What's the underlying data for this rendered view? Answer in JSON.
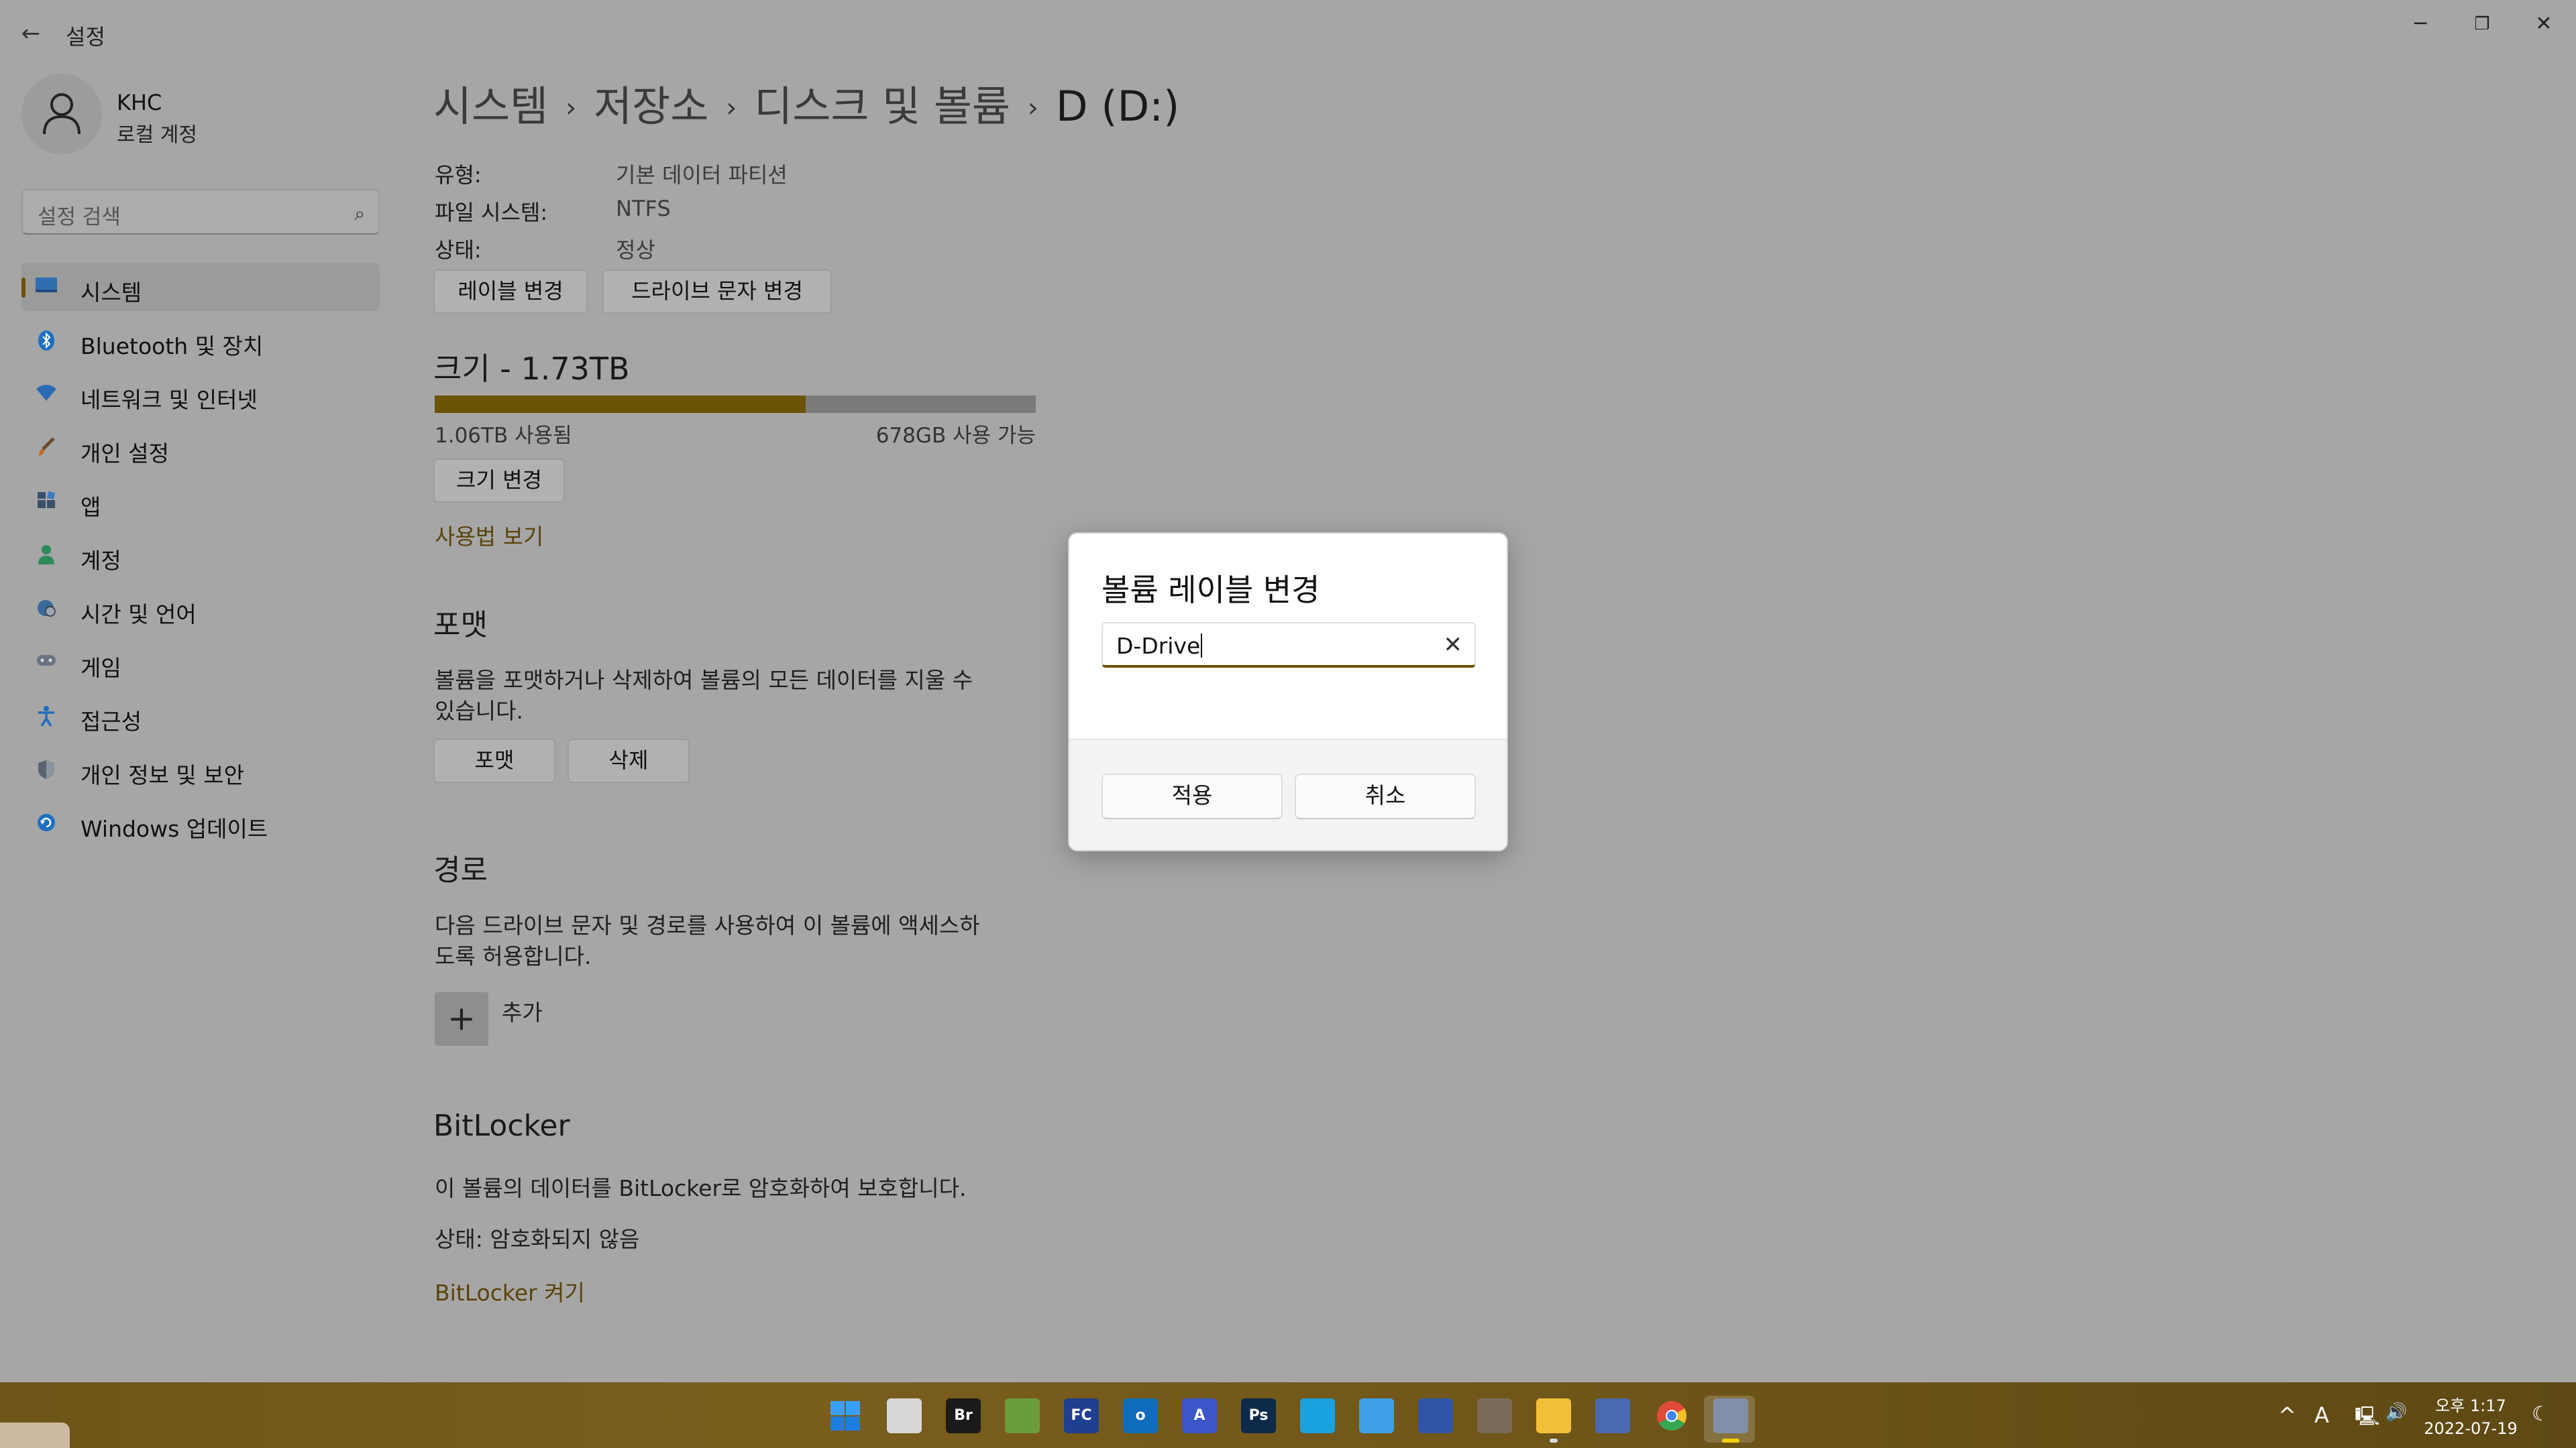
{
  "window": {
    "title": "설정",
    "back": "←",
    "controls": {
      "minimize": "─",
      "restore": "❐",
      "close": "✕"
    }
  },
  "profile": {
    "name": "KHC",
    "account": "로컬 계정"
  },
  "search": {
    "placeholder": "설정 검색"
  },
  "sidebar": {
    "items": [
      {
        "label": "시스템",
        "icon": "system-icon",
        "active": true
      },
      {
        "label": "Bluetooth 및 장치",
        "icon": "bluetooth-icon"
      },
      {
        "label": "네트워크 및 인터넷",
        "icon": "network-icon"
      },
      {
        "label": "개인 설정",
        "icon": "brush-icon"
      },
      {
        "label": "앱",
        "icon": "apps-icon"
      },
      {
        "label": "계정",
        "icon": "account-icon"
      },
      {
        "label": "시간 및 언어",
        "icon": "globe-clock-icon"
      },
      {
        "label": "게임",
        "icon": "gamepad-icon"
      },
      {
        "label": "접근성",
        "icon": "accessibility-icon"
      },
      {
        "label": "개인 정보 및 보안",
        "icon": "shield-icon"
      },
      {
        "label": "Windows 업데이트",
        "icon": "update-icon"
      }
    ]
  },
  "breadcrumb": {
    "items": [
      "시스템",
      "저장소",
      "디스크 및 볼륨",
      "D (D:)"
    ],
    "separator": "›"
  },
  "properties": [
    {
      "key": "유형:",
      "value": "기본 데이터 파티션"
    },
    {
      "key": "파일 시스템:",
      "value": "NTFS"
    },
    {
      "key": "상태:",
      "value": "정상"
    }
  ],
  "actions": {
    "change_label": "레이블 변경",
    "change_letter": "드라이브 문자 변경"
  },
  "size": {
    "title": "크기 - 1.73TB",
    "used": "1.06TB 사용됨",
    "free": "678GB 사용 가능",
    "used_fraction": 0.617,
    "resize": "크기 변경",
    "usage_link": "사용법 보기"
  },
  "format": {
    "title": "포맷",
    "desc_line1": "볼륨을 포맷하거나 삭제하여 볼륨의 모든 데이터를 지울 수",
    "desc_line2": "있습니다.",
    "format_btn": "포맷",
    "delete_btn": "삭제"
  },
  "paths": {
    "title": "경로",
    "desc_line1": "다음 드라이브 문자 및 경로를 사용하여 이 볼륨에 액세스하",
    "desc_line2": "도록 허용합니다.",
    "add_icon": "+",
    "add": "추가"
  },
  "bitlocker": {
    "title": "BitLocker",
    "desc": "이 볼륨의 데이터를 BitLocker로 암호화하여 보호합니다.",
    "status": "상태: 암호화되지 않음",
    "link": "BitLocker 켜기"
  },
  "dialog": {
    "title": "볼륨 레이블 변경",
    "input_value": "D-Drive",
    "clear": "✕",
    "apply": "적용",
    "cancel": "취소"
  },
  "taskbar": {
    "icons": [
      {
        "name": "start-icon",
        "text": "",
        "color": "#2a8cff"
      },
      {
        "name": "task-view-icon",
        "text": "",
        "color": "#d8d8d8"
      },
      {
        "name": "adobe-bridge-icon",
        "text": "Br",
        "color": "#1a1a1a"
      },
      {
        "name": "green-app-icon",
        "text": "",
        "color": "#6b9e3a"
      },
      {
        "name": "fc-app-icon",
        "text": "FC",
        "color": "#1f3f8f"
      },
      {
        "name": "outlook-icon",
        "text": "o",
        "color": "#0f6cbd"
      },
      {
        "name": "text-tool-icon",
        "text": "A",
        "color": "#3a56c8"
      },
      {
        "name": "photoshop-icon",
        "text": "Ps",
        "color": "#0d2a4a"
      },
      {
        "name": "remote-desktop-icon",
        "text": "",
        "color": "#1aa1e0"
      },
      {
        "name": "notepad-icon",
        "text": "",
        "color": "#3fa0e8"
      },
      {
        "name": "floppy-icon",
        "text": "",
        "color": "#3254a8"
      },
      {
        "name": "media-app-icon",
        "text": "",
        "color": "#7a6a5a"
      },
      {
        "name": "file-explorer-icon",
        "text": "",
        "color": "#f2c038"
      },
      {
        "name": "network-tool-icon",
        "text": "",
        "color": "#4a6ab0"
      },
      {
        "name": "chrome-icon",
        "text": "",
        "color": "#e04a3a"
      },
      {
        "name": "settings-taskbar-icon",
        "text": "",
        "color": "#8090a8"
      }
    ],
    "tray": {
      "chevron": "^",
      "ime": "A",
      "network": "🖳",
      "volume": "🔊",
      "moon": "☾"
    },
    "clock": {
      "period_time": "오후 1:17",
      "date": "2022-07-19"
    }
  },
  "colors": {
    "accent": "#6b5307",
    "bar_track": "#7a7a7a",
    "dialog_bg": "#ffffff"
  }
}
